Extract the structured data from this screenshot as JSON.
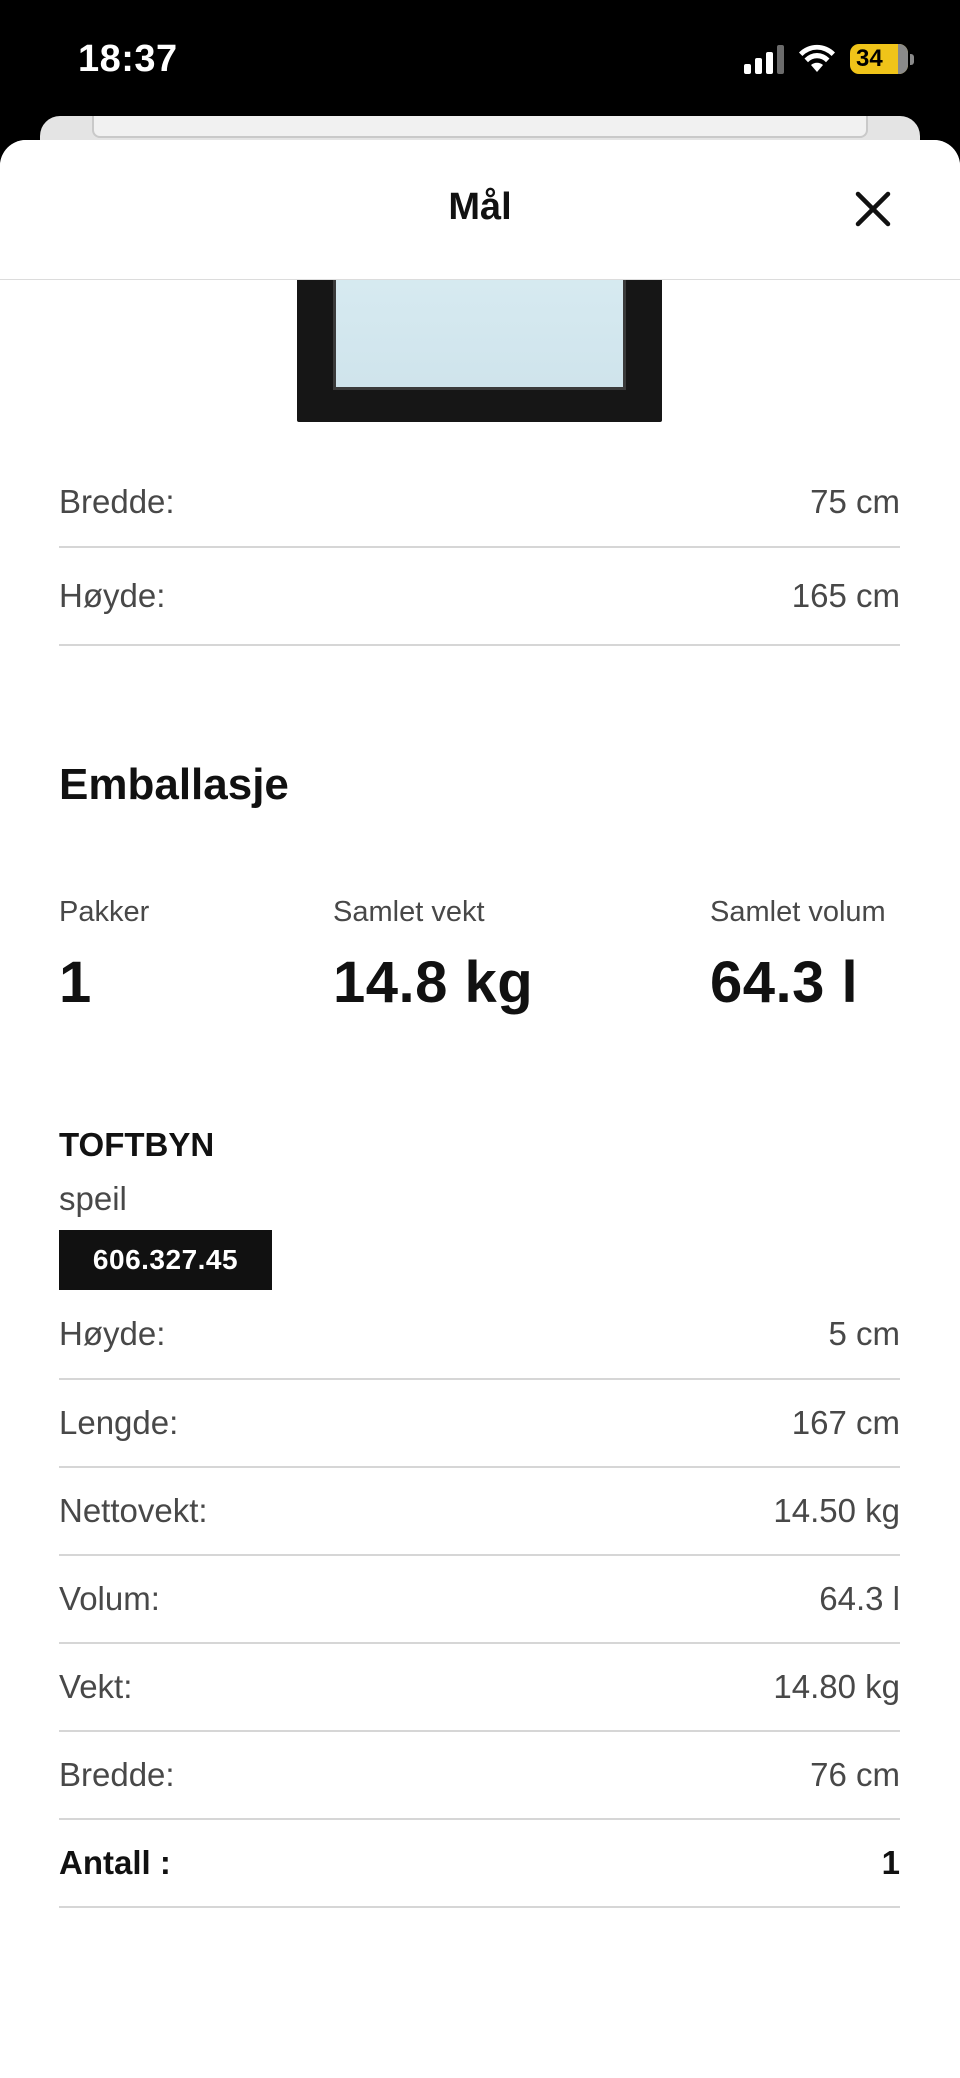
{
  "status": {
    "time": "18:37",
    "battery": "34"
  },
  "sheet": {
    "title": "Mål"
  },
  "product_dimensions": [
    {
      "label": "Bredde:",
      "value": "75 cm"
    },
    {
      "label": "Høyde:",
      "value": "165 cm"
    }
  ],
  "packaging": {
    "title": "Emballasje",
    "stats": [
      {
        "label": "Pakker",
        "value": "1"
      },
      {
        "label": "Samlet vekt",
        "value": "14.8 kg"
      },
      {
        "label": "Samlet volum",
        "value": "64.3 l"
      }
    ]
  },
  "package": {
    "name": "TOFTBYN",
    "type": "speil",
    "article_number": "606.327.45",
    "rows": [
      {
        "label": "Høyde:",
        "value": "5 cm"
      },
      {
        "label": "Lengde:",
        "value": "167 cm"
      },
      {
        "label": "Nettovekt:",
        "value": "14.50 kg"
      },
      {
        "label": "Volum:",
        "value": "64.3 l"
      },
      {
        "label": "Vekt:",
        "value": "14.80 kg"
      },
      {
        "label": "Bredde:",
        "value": "76 cm"
      },
      {
        "label": "Antall :",
        "value": "1"
      }
    ]
  }
}
